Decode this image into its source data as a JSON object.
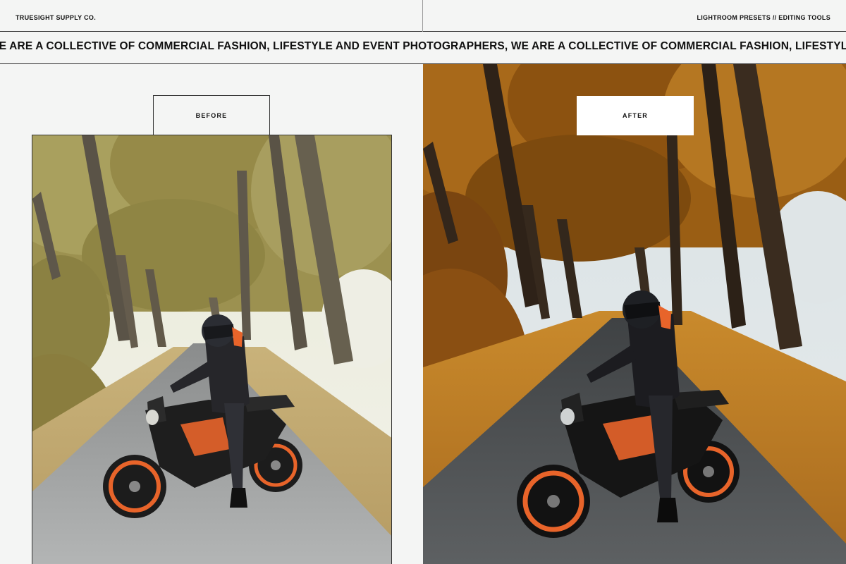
{
  "header": {
    "brand": "TRUESIGHT SUPPLY CO.",
    "tagline": "LIGHTROOM PRESETS // EDITING TOOLS"
  },
  "marquee": {
    "text": "WE ARE A COLLECTIVE OF COMMERCIAL FASHION, LIFESTYLE AND EVENT PHOTOGRAPHERS, WE ARE A COLLECTIVE OF COMMERCIAL FASHION, LIFESTYLE AND EVENT PHOTOGRAPHERS,"
  },
  "comparison": {
    "before_label": "BEFORE",
    "after_label": "AFTER"
  },
  "colors": {
    "background": "#f4f5f4",
    "before_foliage": "#a89a5a",
    "after_foliage": "#b8741c",
    "motorcycle_accent": "#e8642a"
  }
}
